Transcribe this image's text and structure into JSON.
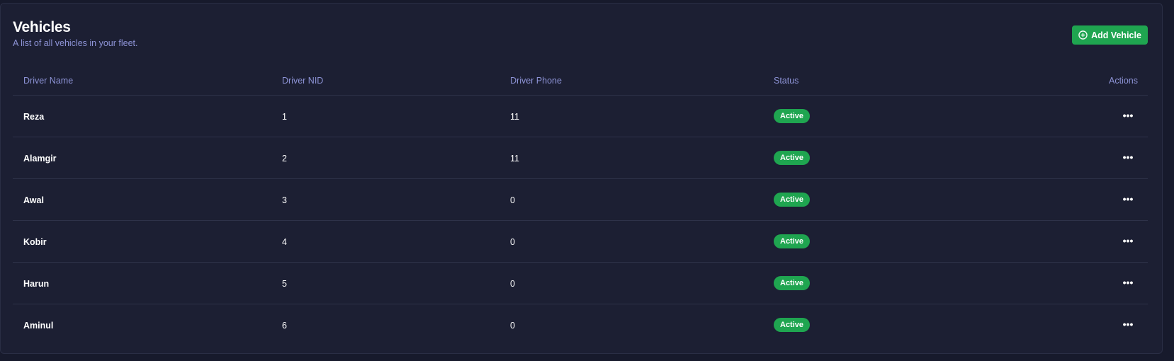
{
  "header": {
    "title": "Vehicles",
    "subtitle": "A list of all vehicles in your fleet.",
    "add_button_label": "Add Vehicle",
    "add_button_icon": "plus-circle-icon"
  },
  "table": {
    "columns": [
      "Driver Name",
      "Driver NID",
      "Driver Phone",
      "Status",
      "Actions"
    ],
    "rows": [
      {
        "name": "Reza",
        "nid": "1",
        "phone": "11",
        "status": "Active"
      },
      {
        "name": "Alamgir",
        "nid": "2",
        "phone": "11",
        "status": "Active"
      },
      {
        "name": "Awal",
        "nid": "3",
        "phone": "0",
        "status": "Active"
      },
      {
        "name": "Kobir",
        "nid": "4",
        "phone": "0",
        "status": "Active"
      },
      {
        "name": "Harun",
        "nid": "5",
        "phone": "0",
        "status": "Active"
      },
      {
        "name": "Aminul",
        "nid": "6",
        "phone": "0",
        "status": "Active"
      }
    ],
    "row_action_icon": "more-horizontal-icon"
  },
  "colors": {
    "background": "#171a2c",
    "card": "#1c1f33",
    "accent_green": "#1fa550",
    "muted_text": "#8d93d6"
  }
}
